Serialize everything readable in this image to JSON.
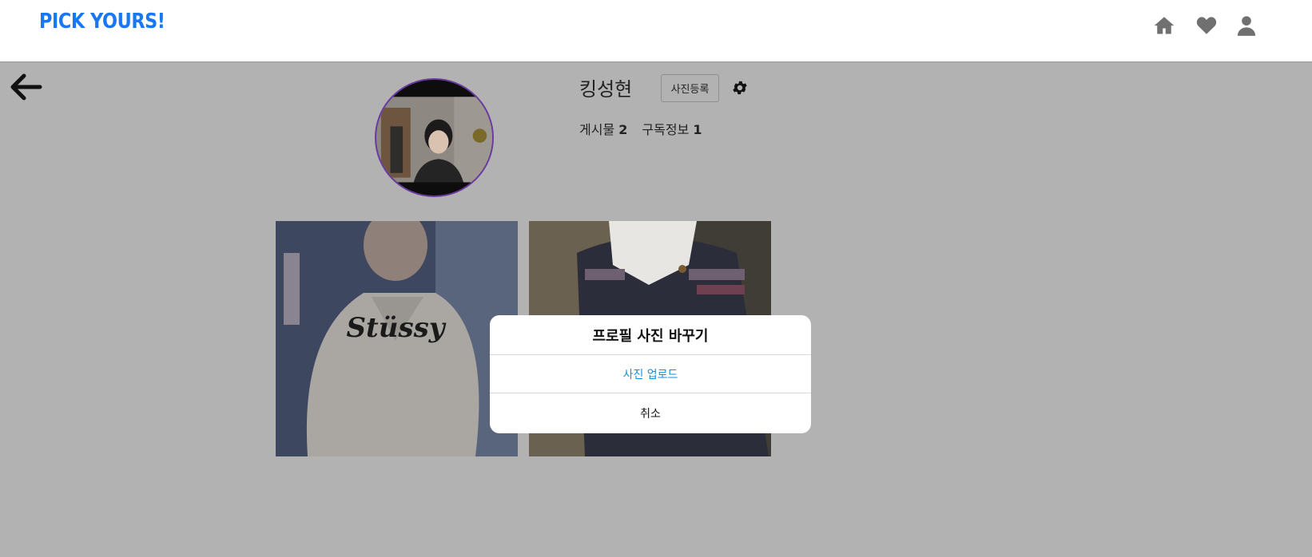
{
  "header": {
    "brand": "PICK YOURS!",
    "brand_color": "#1877f2",
    "icons": [
      "home-icon",
      "heart-icon",
      "user-icon"
    ]
  },
  "profile": {
    "username": "킹성현",
    "upload_button": "사진등록",
    "settings_icon": "gear-icon",
    "stats": {
      "posts_label": "게시물",
      "posts_count": "2",
      "subscriptions_label": "구독정보",
      "subscriptions_count": "1"
    }
  },
  "modal": {
    "title": "프로필 사진 바꾸기",
    "upload_label": "사진 업로드",
    "cancel_label": "취소",
    "upload_color": "#1a8fd6"
  }
}
